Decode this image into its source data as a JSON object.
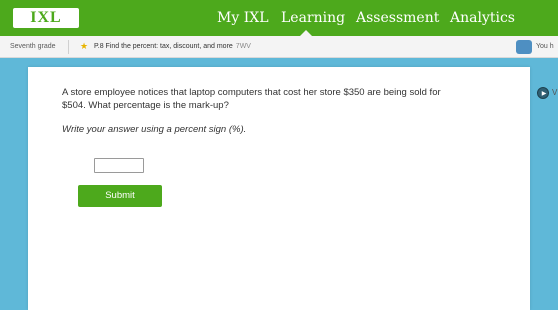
{
  "nav": {
    "logo": "IXL",
    "items": [
      {
        "label": "My IXL"
      },
      {
        "label": "Learning"
      },
      {
        "label": "Assessment"
      },
      {
        "label": "Analytics"
      }
    ],
    "bar_color": "#4da91c"
  },
  "breadcrumb": {
    "grade": "Seventh grade",
    "skill": "P.8 Find the percent: tax, discount, and more",
    "skill_extra": "7WV",
    "help": "You h"
  },
  "question": {
    "line1": "A store employee notices that laptop computers that cost her store $350 are being sold for",
    "line2": "$504. What percentage is the mark-up?",
    "instruction": "Write your answer using a percent sign (%).",
    "answer_value": "",
    "submit_label": "Submit"
  },
  "side": {
    "badge_icon": "video-icon",
    "text": "V"
  }
}
